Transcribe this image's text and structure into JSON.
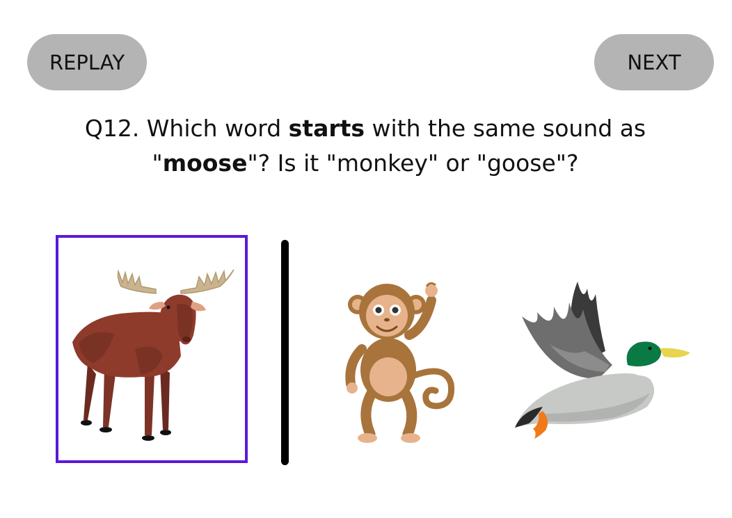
{
  "buttons": {
    "replay_label": "REPLAY",
    "next_label": "NEXT"
  },
  "question": {
    "part1": "Q12. Which word ",
    "bold1": "starts",
    "part2": " with the same sound as",
    "part3": "\"",
    "bold2": "moose",
    "part4": "\"? Is it \"monkey\" or \"goose\"?"
  },
  "prompt_image": {
    "icon": "moose-icon",
    "selected_border_color": "#5b19d6"
  },
  "choices": [
    {
      "icon": "monkey-icon"
    },
    {
      "icon": "duck-icon"
    }
  ],
  "colors": {
    "button_bg": "#b4b4b4",
    "divider": "#000000"
  }
}
